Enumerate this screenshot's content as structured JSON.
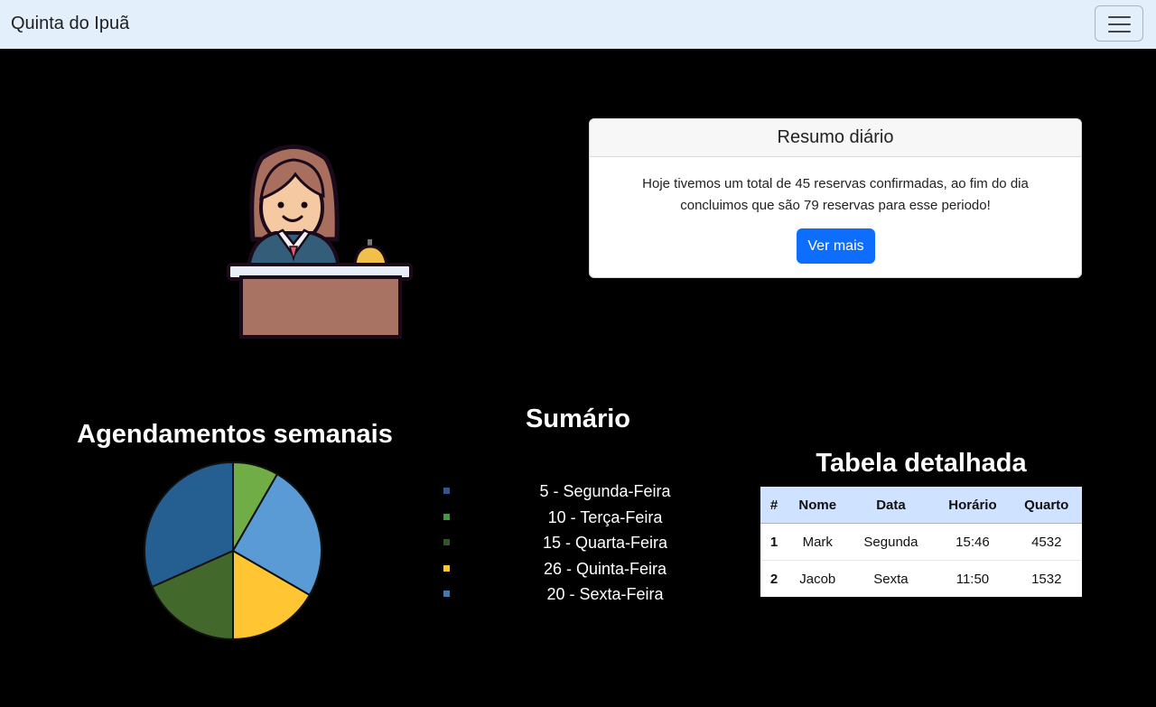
{
  "navbar": {
    "brand": "Quinta do Ipuã",
    "toggle_icon": "hamburger-menu-icon"
  },
  "hero": {
    "illustration": "receptionist-desk-illustration"
  },
  "summary_card": {
    "title": "Resumo diário",
    "text": "Hoje tivemos um total de 45 reservas confirmadas, ao fim do dia concluimos que são 79 reservas para esse periodo!",
    "button_label": "Ver mais"
  },
  "pie_section": {
    "title": "Agendamentos semanais"
  },
  "summary_section": {
    "title": "Sumário",
    "items": [
      {
        "label": "5 - Segunda-Feira",
        "color": "#2f5597"
      },
      {
        "label": "10 - Terça-Feira",
        "color": "#3aa035"
      },
      {
        "label": "15 - Quarta-Feira",
        "color": "#2d5a1f"
      },
      {
        "label": "26 - Quinta-Feira",
        "color": "#ffc52f"
      },
      {
        "label": "20 - Sexta-Feira",
        "color": "#3f7ab3"
      }
    ]
  },
  "chart_data": {
    "type": "pie",
    "title": "Agendamentos semanais",
    "slices": [
      {
        "value": 5,
        "color": "#70ad47"
      },
      {
        "value": 15,
        "color": "#5b9bd5"
      },
      {
        "value": 10,
        "color": "#ffc532"
      },
      {
        "value": 11,
        "color": "#43682b"
      },
      {
        "value": 19,
        "color": "#255e91"
      }
    ]
  },
  "detail_table": {
    "title": "Tabela detalhada",
    "headers": [
      "#",
      "Nome",
      "Data",
      "Horário",
      "Quarto"
    ],
    "rows": [
      [
        "1",
        "Mark",
        "Segunda",
        "15:46",
        "4532"
      ],
      [
        "2",
        "Jacob",
        "Sexta",
        "11:50",
        "1532"
      ]
    ]
  }
}
